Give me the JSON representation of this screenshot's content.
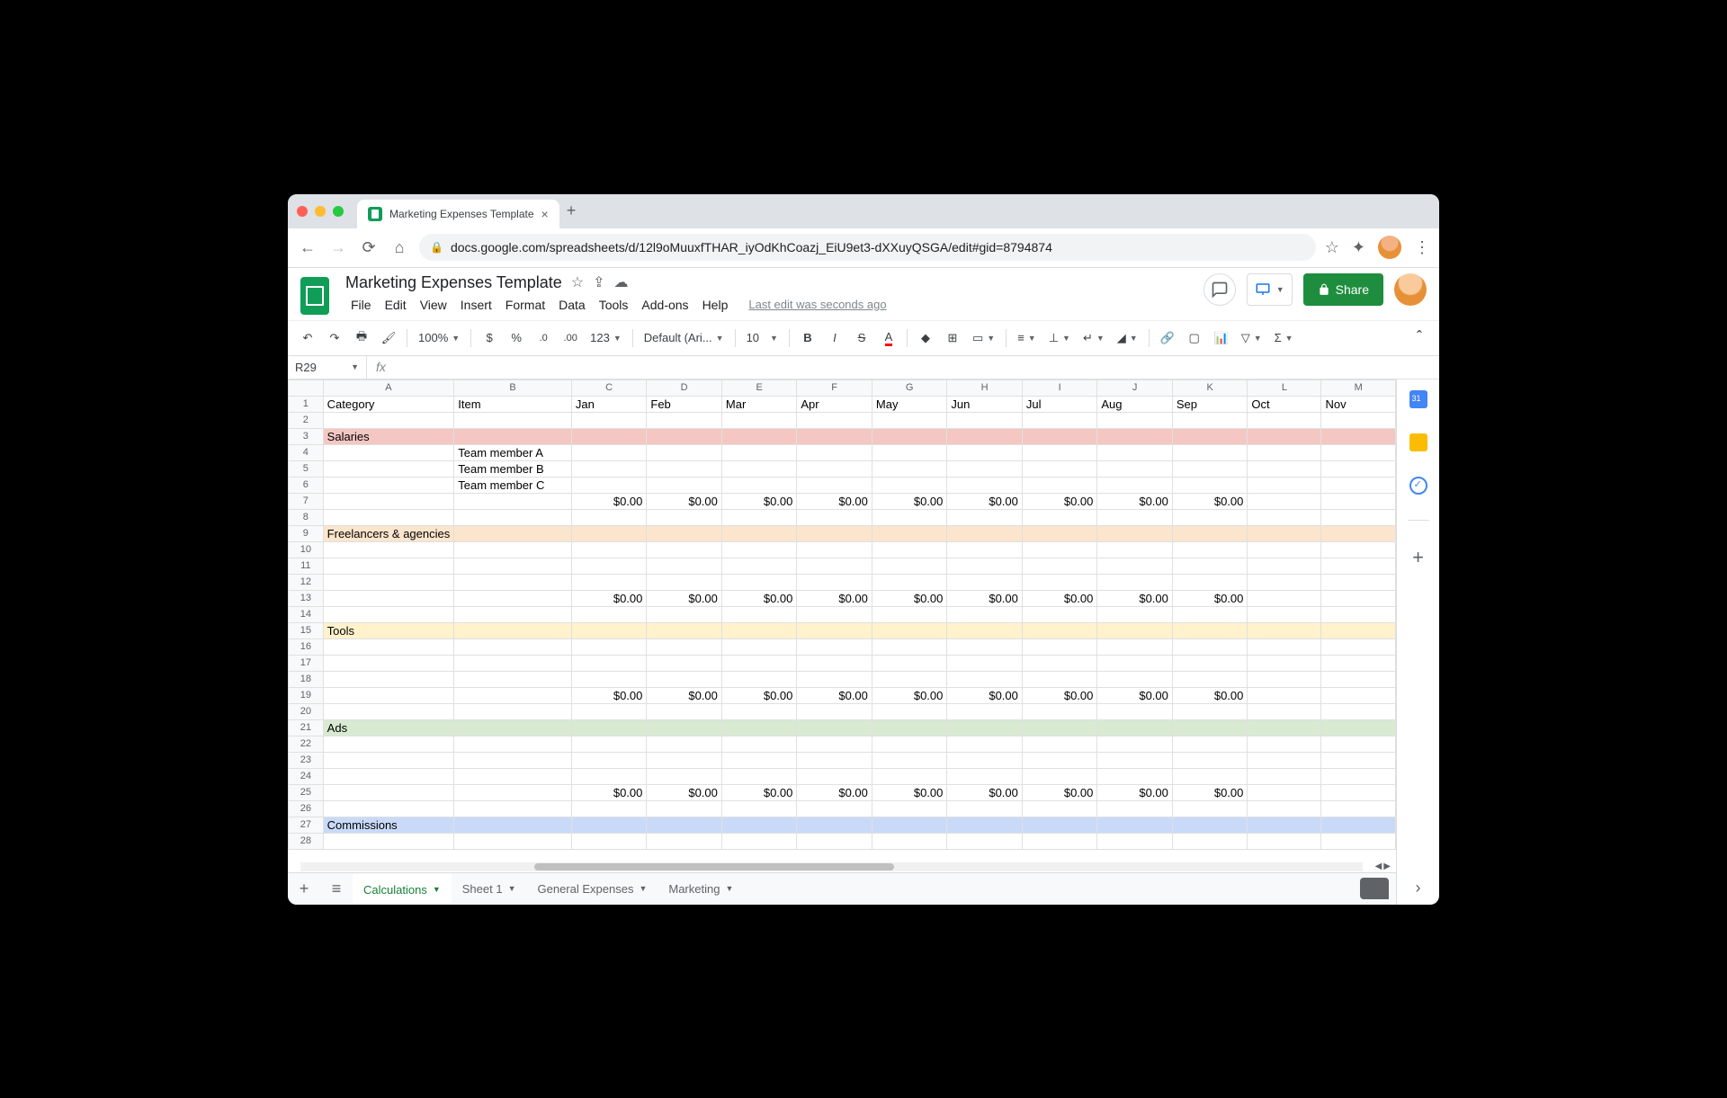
{
  "browser": {
    "tab_title": "Marketing Expenses Template",
    "url_display": "docs.google.com/spreadsheets/d/12l9oMuuxfTHAR_iyOdKhCoazj_EiU9et3-dXXuyQSGA/edit#gid=8794874"
  },
  "doc": {
    "title": "Marketing Expenses Template",
    "last_edit": "Last edit was seconds ago",
    "share_label": "Share"
  },
  "menubar": [
    "File",
    "Edit",
    "View",
    "Insert",
    "Format",
    "Data",
    "Tools",
    "Add-ons",
    "Help"
  ],
  "toolbar": {
    "zoom": "100%",
    "font": "Default (Ari...",
    "font_size": "10"
  },
  "namebox": "R29",
  "columns": [
    "A",
    "B",
    "C",
    "D",
    "E",
    "F",
    "G",
    "H",
    "I",
    "J",
    "K",
    "L",
    "M"
  ],
  "col_headers": [
    "Category",
    "Item",
    "Jan",
    "Feb",
    "Mar",
    "Apr",
    "May",
    "Jun",
    "Jul",
    "Aug",
    "Sep",
    "Oct",
    "Nov"
  ],
  "rows": [
    {
      "n": 1,
      "type": "header"
    },
    {
      "n": 2,
      "type": "blank"
    },
    {
      "n": 3,
      "type": "section",
      "cls": "row-salaries",
      "a": "Salaries"
    },
    {
      "n": 4,
      "type": "item",
      "b": "Team member A"
    },
    {
      "n": 5,
      "type": "item",
      "b": "Team member B"
    },
    {
      "n": 6,
      "type": "item",
      "b": "Team member C"
    },
    {
      "n": 7,
      "type": "total",
      "vals": [
        "$0.00",
        "$0.00",
        "$0.00",
        "$0.00",
        "$0.00",
        "$0.00",
        "$0.00",
        "$0.00",
        "$0.00"
      ]
    },
    {
      "n": 8,
      "type": "blank"
    },
    {
      "n": 9,
      "type": "section",
      "cls": "row-freelancers",
      "a": "Freelancers & agencies"
    },
    {
      "n": 10,
      "type": "blank"
    },
    {
      "n": 11,
      "type": "blank"
    },
    {
      "n": 12,
      "type": "blank"
    },
    {
      "n": 13,
      "type": "total",
      "vals": [
        "$0.00",
        "$0.00",
        "$0.00",
        "$0.00",
        "$0.00",
        "$0.00",
        "$0.00",
        "$0.00",
        "$0.00"
      ]
    },
    {
      "n": 14,
      "type": "blank"
    },
    {
      "n": 15,
      "type": "section",
      "cls": "row-tools",
      "a": "Tools"
    },
    {
      "n": 16,
      "type": "blank"
    },
    {
      "n": 17,
      "type": "blank"
    },
    {
      "n": 18,
      "type": "blank"
    },
    {
      "n": 19,
      "type": "total",
      "vals": [
        "$0.00",
        "$0.00",
        "$0.00",
        "$0.00",
        "$0.00",
        "$0.00",
        "$0.00",
        "$0.00",
        "$0.00"
      ]
    },
    {
      "n": 20,
      "type": "blank"
    },
    {
      "n": 21,
      "type": "section",
      "cls": "row-ads",
      "a": "Ads"
    },
    {
      "n": 22,
      "type": "blank"
    },
    {
      "n": 23,
      "type": "blank"
    },
    {
      "n": 24,
      "type": "blank"
    },
    {
      "n": 25,
      "type": "total",
      "vals": [
        "$0.00",
        "$0.00",
        "$0.00",
        "$0.00",
        "$0.00",
        "$0.00",
        "$0.00",
        "$0.00",
        "$0.00"
      ]
    },
    {
      "n": 26,
      "type": "blank"
    },
    {
      "n": 27,
      "type": "section",
      "cls": "row-commissions",
      "a": "Commissions"
    },
    {
      "n": 28,
      "type": "blank"
    }
  ],
  "sheet_tabs": [
    {
      "label": "Calculations",
      "active": true
    },
    {
      "label": "Sheet 1",
      "active": false
    },
    {
      "label": "General Expenses",
      "active": false
    },
    {
      "label": "Marketing",
      "active": false
    }
  ]
}
